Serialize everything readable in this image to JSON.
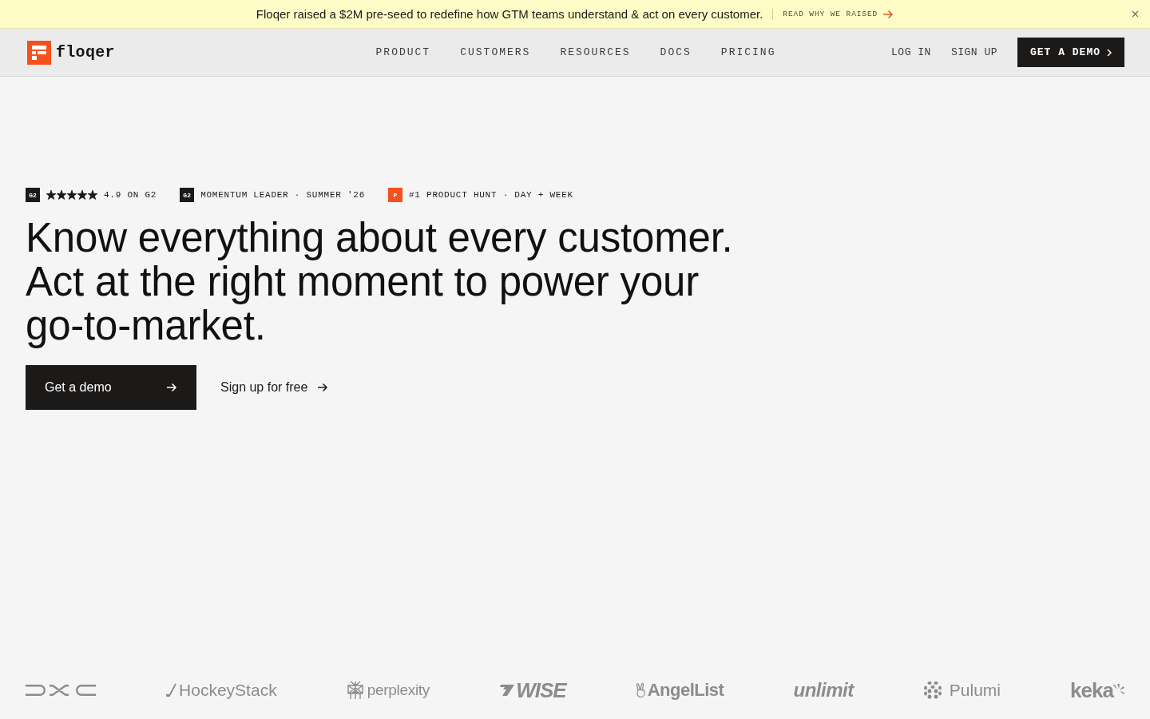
{
  "announcement": {
    "text": "Floqer raised a $2M pre-seed to redefine how GTM teams understand & act on every customer.",
    "link": "READ WHY WE RAISED"
  },
  "nav": {
    "logo": "floqer",
    "links": [
      "PRODUCT",
      "CUSTOMERS",
      "RESOURCES",
      "DOCS",
      "PRICING"
    ],
    "auth": [
      "LOG IN",
      "SIGN UP"
    ],
    "cta": "GET A DEMO"
  },
  "hero": {
    "badges": [
      {
        "kind": "rating",
        "icon": "G2",
        "color": "#1c1a19",
        "stars": 5,
        "text": "4.9 ON G2"
      },
      {
        "kind": "award",
        "icon": "G2",
        "color": "#1c1a19",
        "text": "MOMENTUM LEADER · SUMMER '26"
      },
      {
        "kind": "award",
        "icon": "P",
        "color": "#f4511e",
        "text": "#1 PRODUCT HUNT · DAY + WEEK"
      }
    ],
    "headline": "Know everything about every customer. Act at the right moment to power your go-to-market.",
    "buttons": [
      {
        "kind": "primary",
        "label": "Get a demo"
      },
      {
        "kind": "link",
        "label": "Sign up for free"
      }
    ]
  },
  "logos": [
    {
      "kind": "mark"
    },
    {
      "kind": "stick",
      "name": "HockeyStack"
    },
    {
      "kind": "crystal",
      "name": "perplexity"
    },
    {
      "kind": "flag",
      "name": "WISE"
    },
    {
      "kind": "peace",
      "name": "AngelList"
    },
    {
      "kind": "plain",
      "name": "unlimit"
    },
    {
      "kind": "dots",
      "name": "Pulumi"
    },
    {
      "kind": "burst",
      "name": "keka"
    }
  ]
}
